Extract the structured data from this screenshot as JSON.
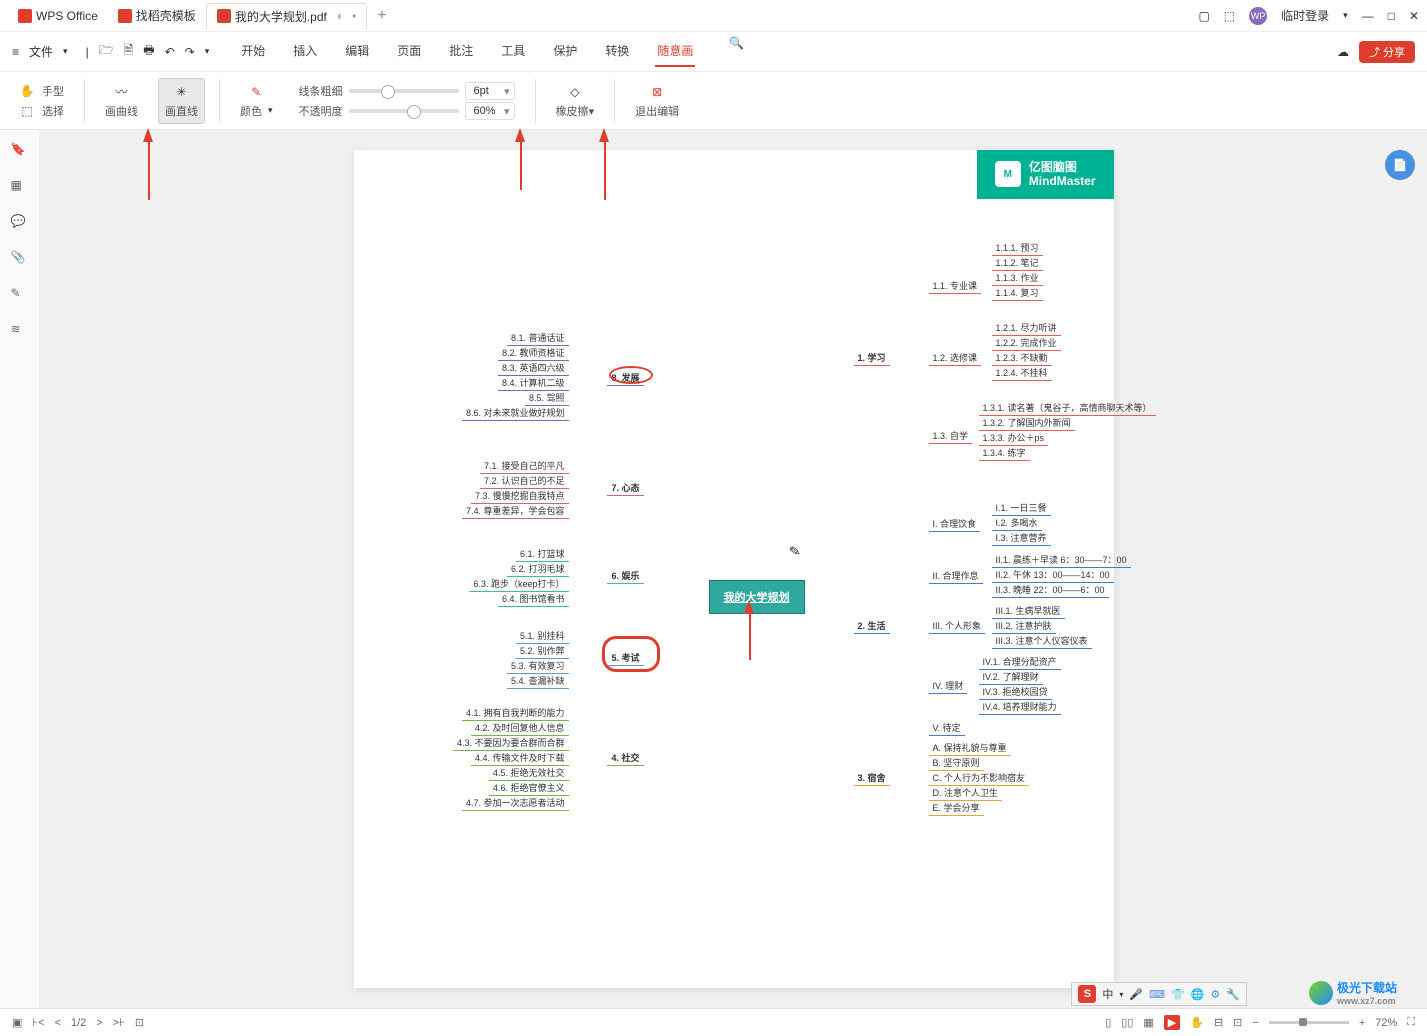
{
  "app": {
    "name": "WPS Office"
  },
  "tabs": [
    {
      "label": "WPS Office"
    },
    {
      "label": "找稻壳模板"
    },
    {
      "label": "我的大学规划.pdf"
    }
  ],
  "titlebar": {
    "login": "临时登录",
    "add": "+"
  },
  "menubar": {
    "file": "文件",
    "tabs": [
      "开始",
      "插入",
      "编辑",
      "页面",
      "批注",
      "工具",
      "保护",
      "转换",
      "随意画"
    ],
    "share": "分享"
  },
  "toolbar": {
    "hand": "手型",
    "select": "选择",
    "curve": "画曲线",
    "line": "画直线",
    "color": "颜色",
    "thickness_label": "线条粗细",
    "opacity_label": "不透明度",
    "thickness_val": "6pt",
    "opacity_val": "60%",
    "eraser": "橡皮擦",
    "exit": "退出编辑"
  },
  "mindmap": {
    "logo1": "亿图脑图",
    "logo2": "MindMaster",
    "center": "我的大学规划",
    "b1": {
      "t": "1. 学习",
      "c": [
        {
          "t": "1.1. 专业课",
          "c": [
            "1.1.1. 预习",
            "1.1.2. 笔记",
            "1.1.3. 作业",
            "1.1.4. 复习"
          ]
        },
        {
          "t": "1.2. 选修课",
          "c": [
            "1.2.1. 尽力听讲",
            "1.2.2. 完成作业",
            "1.2.3. 不缺勤",
            "1.2.4. 不挂科"
          ]
        },
        {
          "t": "1.3. 自学",
          "c": [
            "1.3.1. 读名著（鬼谷子，高情商聊天术等）",
            "1.3.2. 了解国内外新闻",
            "1.3.3. 办公＋ps",
            "1.3.4. 练字"
          ]
        }
      ]
    },
    "b2": {
      "t": "2. 生活",
      "c": [
        {
          "t": "I. 合理饮食",
          "c": [
            "I.1. 一日三餐",
            "I.2. 多喝水",
            "I.3. 注意营养"
          ]
        },
        {
          "t": "II. 合理作息",
          "c": [
            "II.1. 晨练＋早读 6：30——7：00",
            "II.2. 午休 13：00——14：00",
            "II.3. 晚睡 22：00——6：00"
          ]
        },
        {
          "t": "III. 个人形象",
          "c": [
            "III.1. 生病早就医",
            "III.2. 注意护肤",
            "III.3. 注意个人仪容仪表"
          ]
        },
        {
          "t": "IV. 理财",
          "c": [
            "IV.1. 合理分配资产",
            "IV.2. 了解理财",
            "IV.3. 拒绝校园贷",
            "IV.4. 培养理财能力"
          ]
        },
        {
          "t": "V. 待定",
          "c": []
        }
      ]
    },
    "b3": {
      "t": "3. 宿舍",
      "c": [
        "A. 保持礼貌与尊重",
        "B. 坚守原则",
        "C. 个人行为不影响宿友",
        "D. 注意个人卫生",
        "E. 学会分享"
      ]
    },
    "b4": {
      "t": "4. 社交",
      "c": [
        "4.1. 拥有自我判断的能力",
        "4.2. 及时回复他人信息",
        "4.3. 不要因为要合群而合群",
        "4.4. 传输文件及时下载",
        "4.5. 拒绝无效社交",
        "4.6. 拒绝官僚主义",
        "4.7. 参加一次志愿者活动"
      ]
    },
    "b5": {
      "t": "5. 考试",
      "c": [
        "5.1. 别挂科",
        "5.2. 别作弊",
        "5.3. 有效复习",
        "5.4. 查漏补缺"
      ]
    },
    "b6": {
      "t": "6. 娱乐",
      "c": [
        "6.1. 打篮球",
        "6.2. 打羽毛球",
        "6.3. 跑步（keep打卡）",
        "6.4. 图书馆看书"
      ]
    },
    "b7": {
      "t": "7. 心态",
      "c": [
        "7.1. 接受自己的平凡",
        "7.2. 认识自己的不足",
        "7.3. 慢慢挖掘自我特点",
        "7.4. 尊重差异，学会包容"
      ]
    },
    "b8": {
      "t": "8. 发展",
      "c": [
        "8.1. 普通话证",
        "8.2. 教师资格证",
        "8.3. 英语四六级",
        "8.4. 计算机二级",
        "8.5. 驾照",
        "8.6. 对未来就业做好规划"
      ]
    }
  },
  "status": {
    "page": "1/2",
    "zoom": "72%"
  },
  "ime": {
    "s": "S",
    "lang": "中",
    "items": [
      "🎤",
      "⌨",
      "👕",
      "🌐",
      "⚙",
      "🔧"
    ]
  },
  "watermark": {
    "t1": "极光下载站",
    "t2": "www.xz7.com"
  }
}
